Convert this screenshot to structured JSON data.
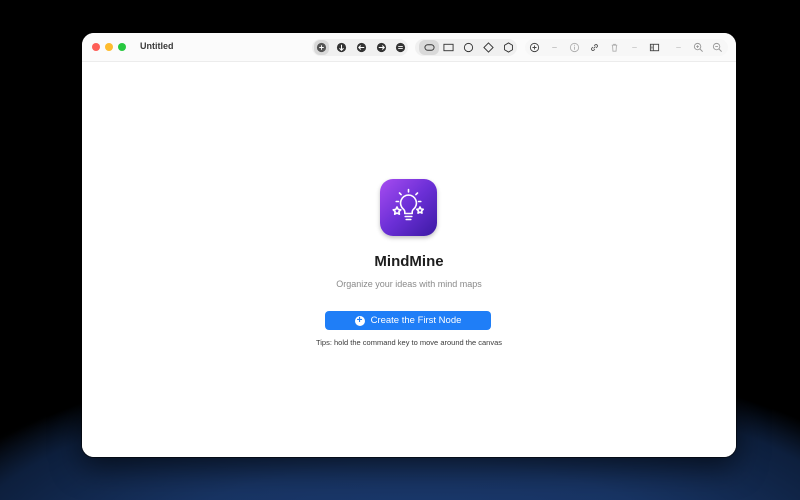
{
  "window": {
    "title": "Untitled"
  },
  "toolbar": {
    "groups": [
      {
        "name": "navigation",
        "icons": [
          "collapse-icon",
          "arrow-down-icon",
          "arrow-left-icon",
          "arrow-right-icon",
          "swap-icon"
        ]
      },
      {
        "name": "shapes",
        "icons": [
          "rounded-rect-shape-icon",
          "rectangle-shape-icon",
          "circle-shape-icon",
          "diamond-shape-icon",
          "hexagon-shape-icon"
        ]
      },
      {
        "name": "actions",
        "icons": [
          "add-icon",
          "minus-icon",
          "info-icon",
          "link-icon",
          "trash-icon",
          "separator-icon",
          "sidebar-icon",
          "minus-icon",
          "zoom-in-icon",
          "zoom-out-icon"
        ]
      }
    ]
  },
  "welcome": {
    "app_name": "MindMine",
    "subtitle": "Organize your ideas with mind maps",
    "create_button_label": "Create the First Node",
    "tips": "Tips: hold the command key to move around the canvas"
  },
  "colors": {
    "accent": "#1f7ef7",
    "icon_gradient_start": "#a64cf0",
    "icon_gradient_end": "#3b1aa3"
  }
}
